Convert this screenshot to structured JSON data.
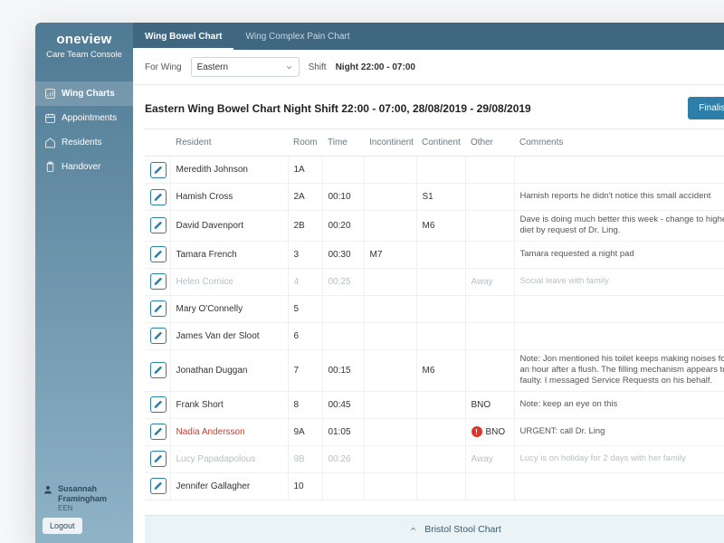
{
  "brand": {
    "name": "oneview",
    "sub": "Care Team Console"
  },
  "nav": {
    "items": [
      {
        "label": "Wing Charts",
        "active": true
      },
      {
        "label": "Appointments",
        "active": false
      },
      {
        "label": "Residents",
        "active": false
      },
      {
        "label": "Handover",
        "active": false
      }
    ]
  },
  "user": {
    "name": "Susannah Framingham",
    "role": "EEN",
    "logout": "Logout"
  },
  "tabs": [
    {
      "label": "Wing Bowel Chart",
      "active": true
    },
    {
      "label": "Wing Complex Pain Chart",
      "active": false
    }
  ],
  "filters": {
    "wing_label": "For Wing",
    "wing_value": "Eastern",
    "shift_label": "Shift",
    "shift_value": "Night 22:00 - 07:00"
  },
  "page": {
    "title": "Eastern Wing Bowel Chart Night Shift 22:00 - 07:00, 28/08/2019 - 29/08/2019",
    "finalise": "Finalise Chart"
  },
  "columns": {
    "resident": "Resident",
    "room": "Room",
    "time": "Time",
    "incontinent": "Incontinent",
    "continent": "Continent",
    "other": "Other",
    "comments": "Comments"
  },
  "rows": [
    {
      "resident": "Meredith Johnson",
      "room": "1A",
      "time": "",
      "incontinent": "",
      "continent": "",
      "other": "",
      "comments": "",
      "state": ""
    },
    {
      "resident": "Hamish Cross",
      "room": "2A",
      "time": "00:10",
      "incontinent": "",
      "continent": "S1",
      "other": "",
      "comments": "Hamish reports he didn't notice this small accident",
      "state": ""
    },
    {
      "resident": "David Davenport",
      "room": "2B",
      "time": "00:20",
      "incontinent": "",
      "continent": "M6",
      "other": "",
      "comments": "Dave is doing much better this week - change to higher fibre diet by request of Dr. Ling.",
      "state": ""
    },
    {
      "resident": "Tamara French",
      "room": "3",
      "time": "00:30",
      "incontinent": "M7",
      "continent": "",
      "other": "",
      "comments": "Tamara requested a night pad",
      "state": ""
    },
    {
      "resident": "Helen Cornice",
      "room": "4",
      "time": "00:25",
      "incontinent": "",
      "continent": "",
      "other": "Away",
      "comments": "Social leave with family",
      "state": "away"
    },
    {
      "resident": "Mary O'Connelly",
      "room": "5",
      "time": "",
      "incontinent": "",
      "continent": "",
      "other": "",
      "comments": "",
      "state": ""
    },
    {
      "resident": "James Van der Sloot",
      "room": "6",
      "time": "",
      "incontinent": "",
      "continent": "",
      "other": "",
      "comments": "",
      "state": ""
    },
    {
      "resident": "Jonathan Duggan",
      "room": "7",
      "time": "00:15",
      "incontinent": "",
      "continent": "M6",
      "other": "",
      "comments": "Note: Jon mentioned his toilet keeps making noises for often an hour after a flush. The filling mechanism appears to be faulty. I messaged Service Requests on his behalf.",
      "state": "tall"
    },
    {
      "resident": "Frank Short",
      "room": "8",
      "time": "00:45",
      "incontinent": "",
      "continent": "",
      "other": "BNO",
      "comments": "Note: keep an eye on this",
      "state": ""
    },
    {
      "resident": "Nadia Andersson",
      "room": "9A",
      "time": "01:05",
      "incontinent": "",
      "continent": "",
      "other": "BNO",
      "comments": "URGENT: call Dr. Ling",
      "state": "alert"
    },
    {
      "resident": "Lucy Papadapolous",
      "room": "9B",
      "time": "00:26",
      "incontinent": "",
      "continent": "",
      "other": "Away",
      "comments": "Lucy is on holiday for 2 days with her family",
      "state": "away"
    },
    {
      "resident": "Jennifer Gallagher",
      "room": "10",
      "time": "",
      "incontinent": "",
      "continent": "",
      "other": "",
      "comments": "",
      "state": ""
    }
  ],
  "bottom_panel": {
    "label": "Bristol Stool Chart"
  }
}
